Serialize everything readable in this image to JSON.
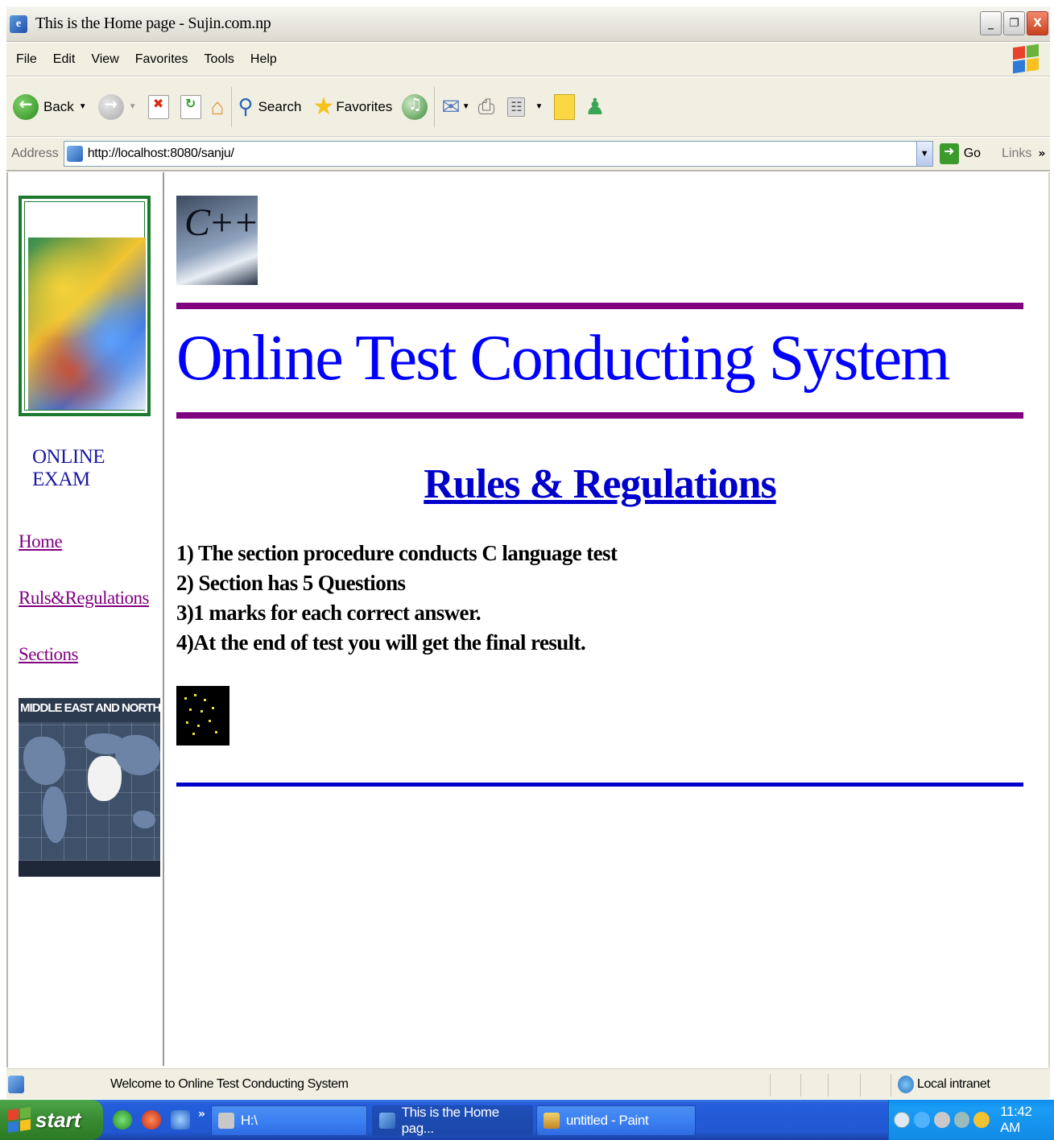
{
  "window": {
    "title": "This is the Home page - Sujin.com.np",
    "app_icon_glyph": "e",
    "controls": {
      "minimize": "_",
      "restore": "❐",
      "close": "X"
    }
  },
  "menubar": [
    "File",
    "Edit",
    "View",
    "Favorites",
    "Tools",
    "Help"
  ],
  "toolbar": {
    "back_label": "Back",
    "search_label": "Search",
    "favorites_label": "Favorites"
  },
  "address_bar": {
    "label": "Address",
    "url": "http://localhost:8080/sanju/",
    "go_label": "Go",
    "links_label": "Links",
    "links_chevron": "»"
  },
  "sidebar": {
    "brand": "ONLINE EXAM",
    "nav": [
      {
        "label": "Home"
      },
      {
        "label": "Ruls&Regulations"
      },
      {
        "label": "Sections"
      }
    ],
    "map_banner_text": "MIDDLE EAST AND NORTH AFR"
  },
  "main": {
    "logo_text": "C++",
    "heading": "Online Test Conducting System",
    "subheading": "Rules & Regulations",
    "rules": [
      "1) The section procedure conducts C language test",
      "2) Section has 5 Questions",
      "3)1 marks for each correct answer.",
      "4)At the end of test you will get the final result."
    ]
  },
  "statusbar": {
    "text": "Welcome to Online Test Conducting System",
    "zone": "Local intranet"
  },
  "taskbar": {
    "start_label": "start",
    "quicklaunch_chevron": "»",
    "buttons": [
      {
        "label": "H:\\"
      },
      {
        "label": "This is the Home pag..."
      },
      {
        "label": "untitled - Paint"
      }
    ],
    "clock": "11:42 AM"
  },
  "colors": {
    "heading_blue": "#0000ff",
    "visited_link": "#800080",
    "rule_purple": "#800080",
    "rule_blue": "#0000cc",
    "frame_green": "#1c7a2e"
  }
}
